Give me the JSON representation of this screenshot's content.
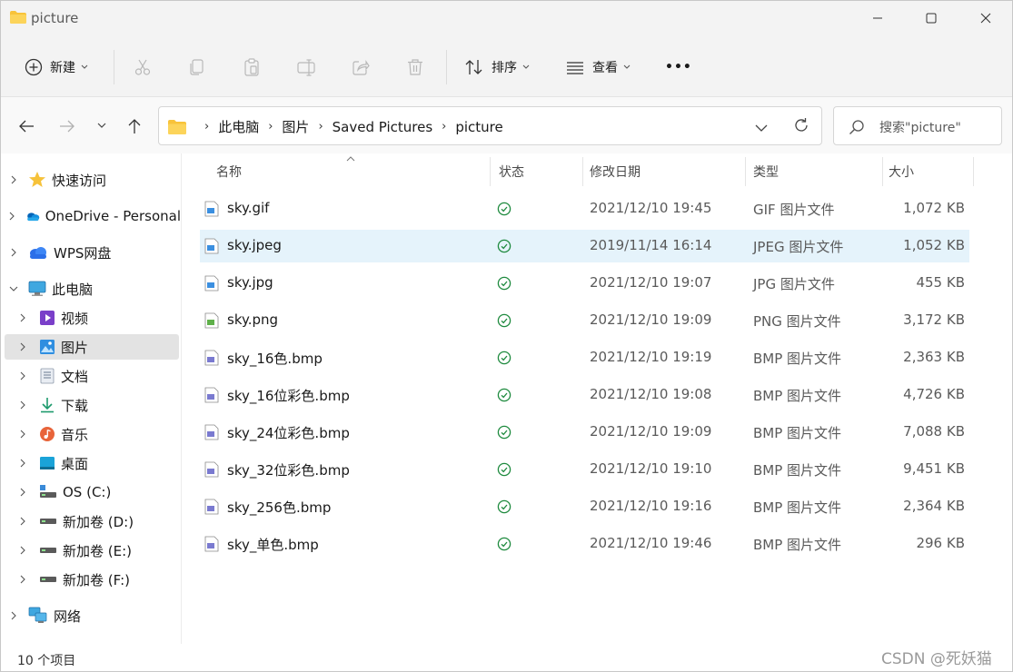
{
  "window": {
    "title": "picture"
  },
  "toolbar": {
    "new_label": "新建",
    "sort_label": "排序",
    "view_label": "查看",
    "more_label": "•••"
  },
  "address": {
    "crumbs": [
      "此电脑",
      "图片",
      "Saved Pictures",
      "picture"
    ],
    "search_placeholder": "搜索\"picture\""
  },
  "sidebar": {
    "items": [
      {
        "label": "快速访问",
        "icon": "star-icon"
      },
      {
        "label": "OneDrive - Personal",
        "icon": "onedrive-icon"
      },
      {
        "label": "WPS网盘",
        "icon": "wps-cloud-icon"
      },
      {
        "label": "此电脑",
        "icon": "computer-icon"
      },
      {
        "label": "视频",
        "icon": "videos-icon"
      },
      {
        "label": "图片",
        "icon": "pictures-icon"
      },
      {
        "label": "文档",
        "icon": "documents-icon"
      },
      {
        "label": "下载",
        "icon": "downloads-icon"
      },
      {
        "label": "音乐",
        "icon": "music-icon"
      },
      {
        "label": "桌面",
        "icon": "desktop-icon"
      },
      {
        "label": "OS (C:)",
        "icon": "drive-icon"
      },
      {
        "label": "新加卷 (D:)",
        "icon": "drive-icon"
      },
      {
        "label": "新加卷 (E:)",
        "icon": "drive-icon"
      },
      {
        "label": "新加卷 (F:)",
        "icon": "drive-icon"
      },
      {
        "label": "网络",
        "icon": "network-icon"
      }
    ]
  },
  "columns": {
    "name": "名称",
    "status": "状态",
    "modified": "修改日期",
    "type": "类型",
    "size": "大小"
  },
  "files": [
    {
      "name": "sky.gif",
      "date": "2021/12/10 19:45",
      "type": "GIF 图片文件",
      "size": "1,072 KB"
    },
    {
      "name": "sky.jpeg",
      "date": "2019/11/14 16:14",
      "type": "JPEG 图片文件",
      "size": "1,052 KB"
    },
    {
      "name": "sky.jpg",
      "date": "2021/12/10 19:07",
      "type": "JPG 图片文件",
      "size": "455 KB"
    },
    {
      "name": "sky.png",
      "date": "2021/12/10 19:09",
      "type": "PNG 图片文件",
      "size": "3,172 KB"
    },
    {
      "name": "sky_16色.bmp",
      "date": "2021/12/10 19:19",
      "type": "BMP 图片文件",
      "size": "2,363 KB"
    },
    {
      "name": "sky_16位彩色.bmp",
      "date": "2021/12/10 19:08",
      "type": "BMP 图片文件",
      "size": "4,726 KB"
    },
    {
      "name": "sky_24位彩色.bmp",
      "date": "2021/12/10 19:09",
      "type": "BMP 图片文件",
      "size": "7,088 KB"
    },
    {
      "name": "sky_32位彩色.bmp",
      "date": "2021/12/10 19:10",
      "type": "BMP 图片文件",
      "size": "9,451 KB"
    },
    {
      "name": "sky_256色.bmp",
      "date": "2021/12/10 19:16",
      "type": "BMP 图片文件",
      "size": "2,364 KB"
    },
    {
      "name": "sky_单色.bmp",
      "date": "2021/12/10 19:46",
      "type": "BMP 图片文件",
      "size": "296 KB"
    }
  ],
  "statusbar": {
    "count": "10 个项目"
  },
  "watermark": "CSDN @死妖猫",
  "colors": {
    "accent": "#0067c0",
    "selection": "#e5f3fb",
    "status_ok": "#1e8a3e",
    "folder": "#f8c33a"
  }
}
